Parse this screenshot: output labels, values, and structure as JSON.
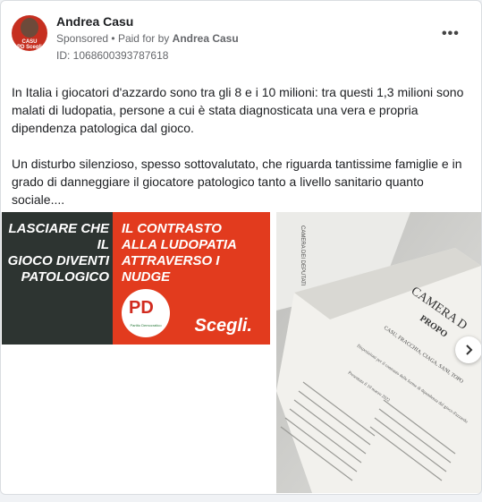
{
  "post": {
    "author": "Andrea Casu",
    "sponsored_label": "Sponsored",
    "paid_for_prefix": "Paid for by",
    "paid_for_name": "Andrea Casu",
    "ad_id": "ID: 1068600393787618",
    "more_icon": "more-dots-icon",
    "body_paragraphs": [
      "In Italia i giocatori d'azzardo sono tra gli 8 e i 10 milioni: tra questi 1,3 milioni sono malati di ludopatia, persone a cui è stata diagnosticata una vera e propria dipendenza patologica dal gioco.",
      "Un disturbo silenzioso, spesso sottovalutato, che riguarda tantissime famiglie e in grado di danneggiare il giocatore patologico tanto a livello sanitario quanto sociale...."
    ]
  },
  "avatar": {
    "tag_line1": "CASU",
    "tag_line2": "PD Scegli"
  },
  "creative1": {
    "left_lines": [
      "LASCIARE CHE IL",
      "GIOCO DIVENTI",
      "PATOLOGICO"
    ],
    "right_lines": [
      "IL CONTRASTO",
      "ALLA LUDOPATIA",
      "ATTRAVERSO I NUDGE"
    ],
    "logo_text": "PD",
    "logo_small": "Partito Democratico",
    "cta": "Scegli."
  },
  "creative2": {
    "doc_header": "CAMERA DEI DEPUTATI",
    "doc_title": "CAMERA D",
    "doc_prop": "PROPO",
    "doc_names": "CASU, FRACCHIA, CIAGA, SANI, TOPO",
    "doc_desc": "Disposizioni per il contrasto delle forme di dipendenza dal gioco d'azzardo",
    "doc_date": "Presentata il 10 marzo 2022"
  },
  "carousel": {
    "next_icon": "chevron-right-icon"
  }
}
